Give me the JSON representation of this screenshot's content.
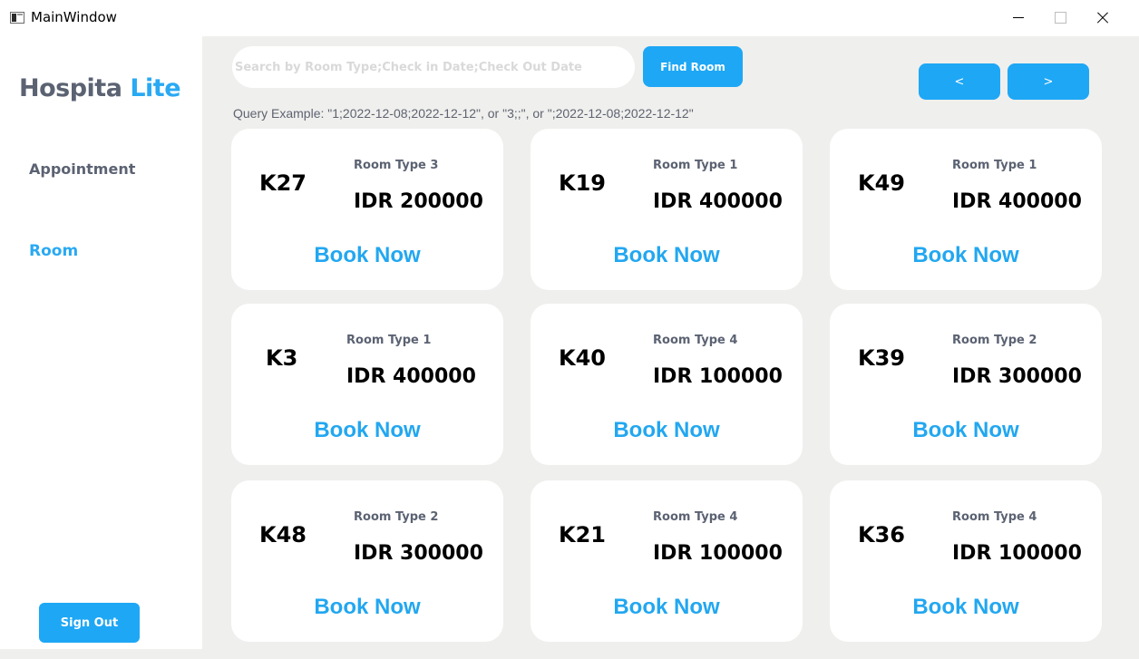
{
  "window": {
    "title": "MainWindow",
    "icon": "app-window-icon"
  },
  "sidebar": {
    "brand_main": "Hospita",
    "brand_accent": "Lite",
    "items": [
      {
        "label": "Appointment",
        "active": false
      },
      {
        "label": "Room",
        "active": true
      }
    ],
    "sign_out_label": "Sign Out"
  },
  "search": {
    "placeholder": "Search by Room Type;Check in Date;Check Out Date",
    "value": "",
    "find_label": "Find Room",
    "hint": "Query Example: \"1;2022-12-08;2022-12-12\", or \"3;;\", or \";2022-12-08;2022-12-12\""
  },
  "pagination": {
    "prev_label": "<",
    "next_label": ">"
  },
  "book_label": "Book Now",
  "rooms": [
    {
      "code": "K27",
      "type": "Room Type 3",
      "price": "IDR 200000"
    },
    {
      "code": "K19",
      "type": "Room Type 1",
      "price": "IDR 400000"
    },
    {
      "code": "K49",
      "type": "Room Type 1",
      "price": "IDR 400000"
    },
    {
      "code": "K3",
      "type": "Room Type 1",
      "price": "IDR 400000"
    },
    {
      "code": "K40",
      "type": "Room Type 4",
      "price": "IDR 100000"
    },
    {
      "code": "K39",
      "type": "Room Type 2",
      "price": "IDR 300000"
    },
    {
      "code": "K48",
      "type": "Room Type 2",
      "price": "IDR 300000"
    },
    {
      "code": "K21",
      "type": "Room Type 4",
      "price": "IDR 100000"
    },
    {
      "code": "K36",
      "type": "Room Type 4",
      "price": "IDR 100000"
    }
  ],
  "colors": {
    "accent": "#1ea7f5",
    "brand_text": "#5b6272",
    "background": "#efefed"
  }
}
